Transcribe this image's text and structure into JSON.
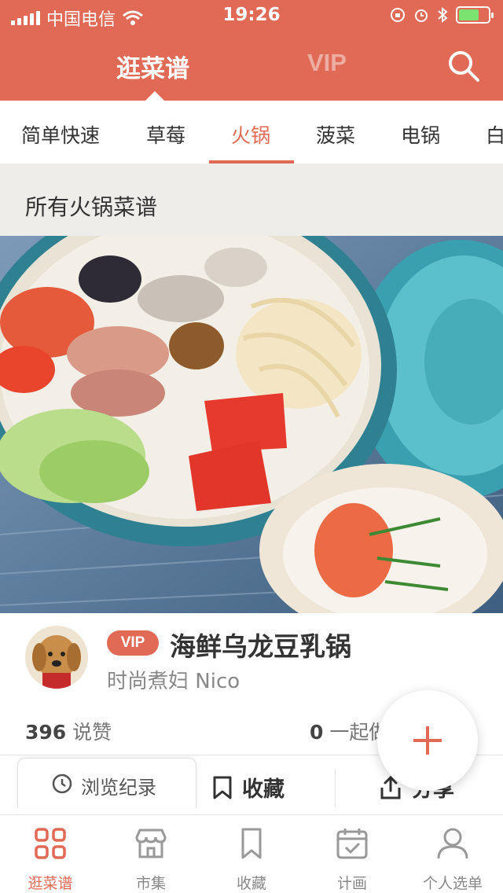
{
  "status_bar": {
    "carrier": "中国电信",
    "time": "19:26"
  },
  "header": {
    "tabs": [
      {
        "label": "逛菜谱",
        "active": true
      },
      {
        "label": "VIP",
        "active": false
      }
    ],
    "search_icon": "search-icon"
  },
  "categories": [
    {
      "label": "简单快速",
      "active": false
    },
    {
      "label": "草莓",
      "active": false
    },
    {
      "label": "火锅",
      "active": true
    },
    {
      "label": "菠菜",
      "active": false
    },
    {
      "label": "电锅",
      "active": false
    },
    {
      "label": "白",
      "active": false
    }
  ],
  "section": {
    "title": "所有火锅菜谱"
  },
  "recipe": {
    "badge": "VIP",
    "title": "海鲜乌龙豆乳锅",
    "author": "时尚煮妇 Nico",
    "likes_count": "396",
    "likes_label": "说赞",
    "together_count": "0",
    "together_label": "一起做"
  },
  "actions": {
    "history": "浏览纪录",
    "favorite": "收藏",
    "share": "分享"
  },
  "tabbar": [
    {
      "label": "逛菜谱",
      "icon": "grid-icon",
      "active": true
    },
    {
      "label": "市集",
      "icon": "shop-icon",
      "active": false
    },
    {
      "label": "收藏",
      "icon": "bookmark-icon",
      "active": false
    },
    {
      "label": "计画",
      "icon": "calendar-icon",
      "active": false
    },
    {
      "label": "个人选单",
      "icon": "person-icon",
      "active": false
    }
  ],
  "colors": {
    "accent": "#e06a56",
    "section_bg": "#efedea"
  }
}
